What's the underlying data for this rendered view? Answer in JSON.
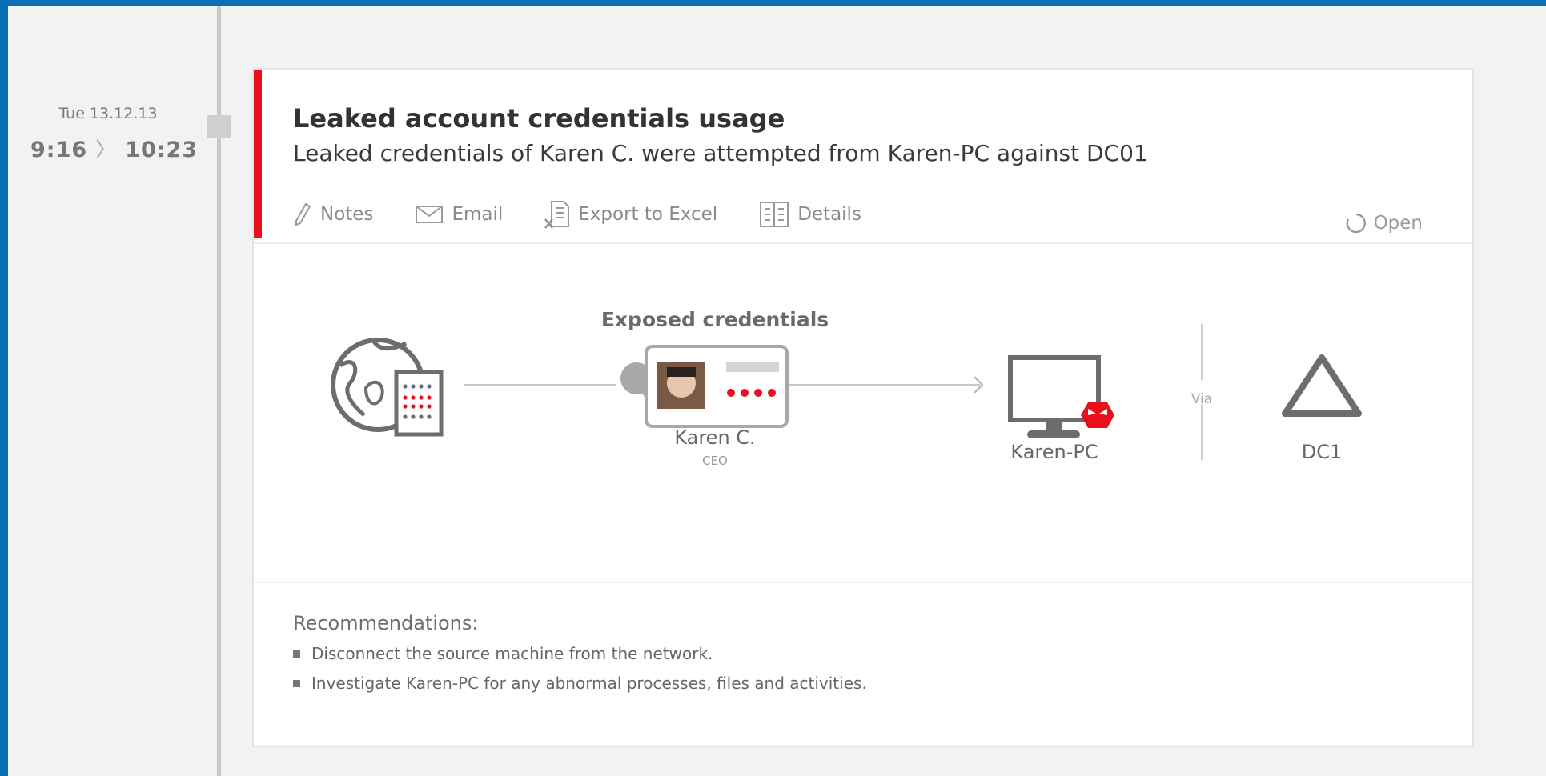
{
  "timeline": {
    "date": "Tue 13.12.13",
    "start_time": "9:16",
    "end_time": "10:23"
  },
  "alert": {
    "title": "Leaked account credentials usage",
    "subtitle": "Leaked credentials of Karen C. were attempted from Karen-PC against DC01",
    "severity_color": "#e8101c",
    "actions": [
      {
        "label": "Notes",
        "icon": "pencil-icon"
      },
      {
        "label": "Email",
        "icon": "envelope-icon"
      },
      {
        "label": "Export to Excel",
        "icon": "excel-export-icon"
      },
      {
        "label": "Details",
        "icon": "details-icon"
      }
    ],
    "status": {
      "label": "Open",
      "icon": "refresh-icon"
    }
  },
  "diagram": {
    "exposed_label": "Exposed credentials",
    "user": {
      "name": "Karen C.",
      "role": "CEO"
    },
    "source_machine": {
      "name": "Karen-PC"
    },
    "via_label": "Via",
    "target": {
      "name": "DC1"
    }
  },
  "recommendations": {
    "title": "Recommendations:",
    "items": [
      "Disconnect the source machine from the network.",
      "Investigate Karen-PC for any abnormal processes, files and activities."
    ]
  },
  "colors": {
    "accent": "#0a6fb4",
    "alert_red": "#e8101c",
    "icon_gray": "#6d6d6d"
  }
}
